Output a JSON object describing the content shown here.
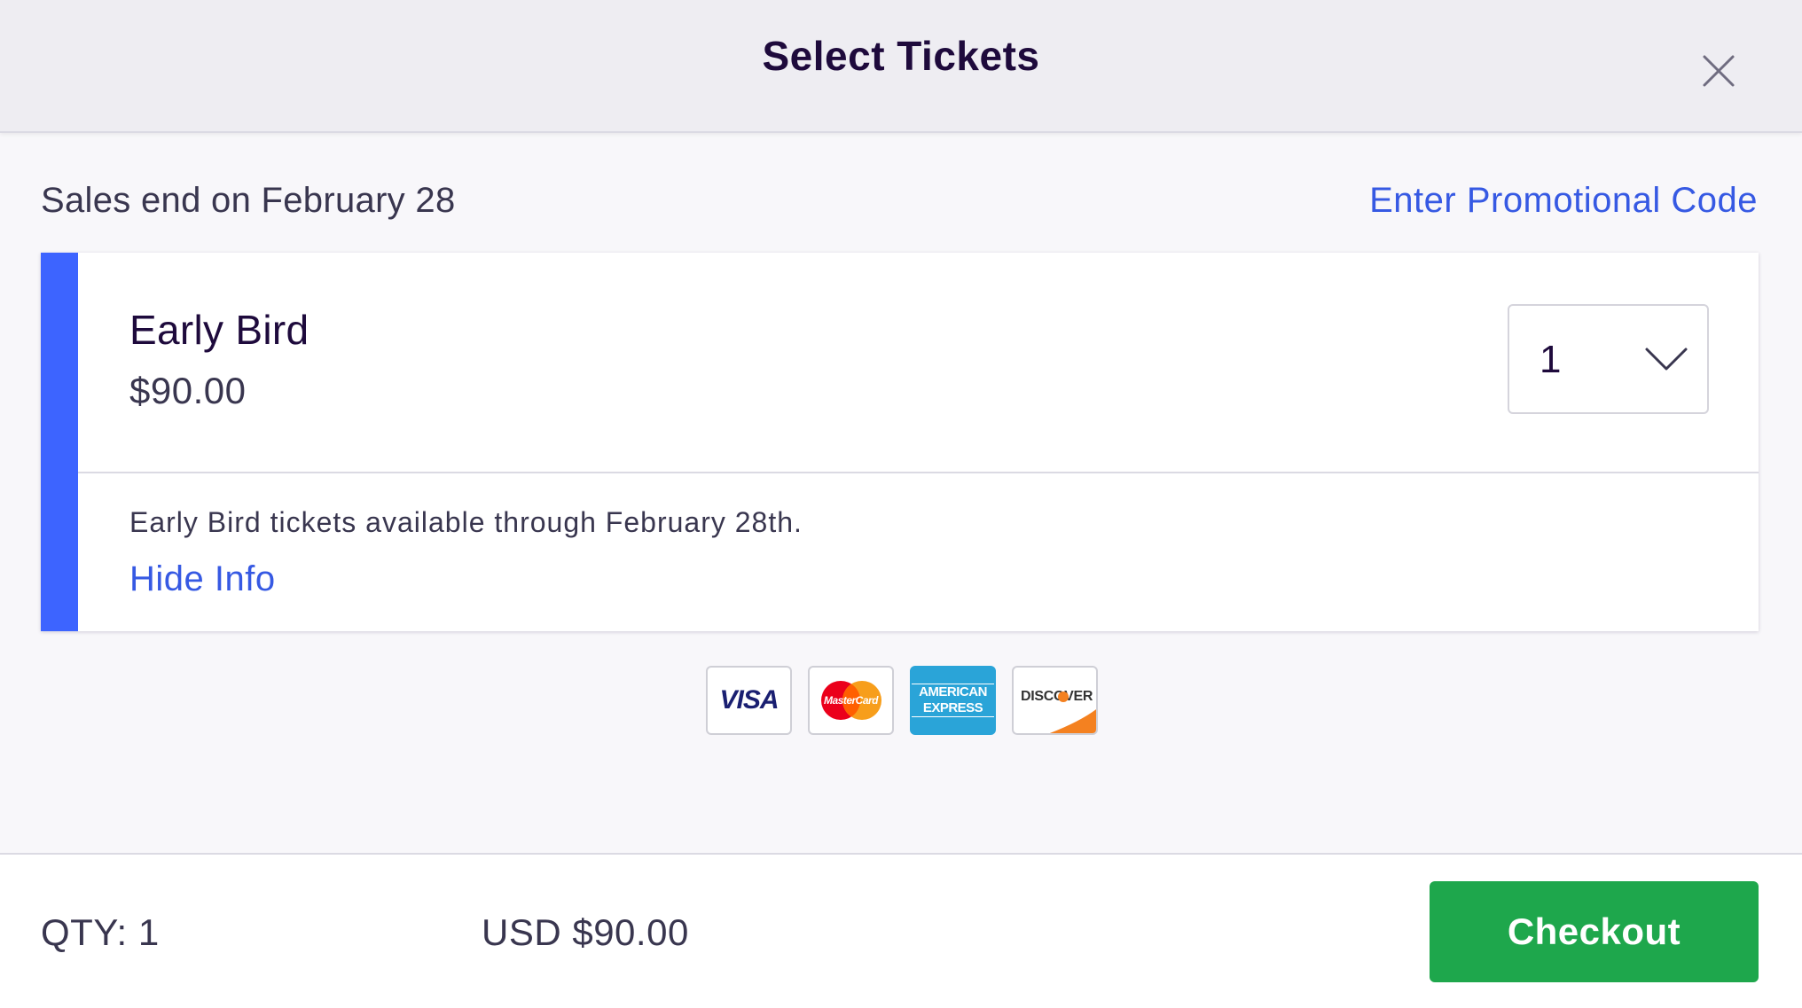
{
  "header": {
    "title": "Select Tickets",
    "close_icon": "close-icon"
  },
  "sales": {
    "end_text": "Sales end on February 28",
    "promo_link": "Enter Promotional Code"
  },
  "ticket": {
    "name": "Early Bird",
    "price": "$90.00",
    "quantity": "1",
    "info": "Early Bird tickets available through February 28th.",
    "hide_info": "Hide Info",
    "accent_color": "#3d64ff"
  },
  "payment_methods": [
    {
      "name": "VISA",
      "icon": "visa-card-icon"
    },
    {
      "name": "MasterCard",
      "icon": "mastercard-icon"
    },
    {
      "name": "AMERICAN EXPRESS",
      "icon": "amex-card-icon"
    },
    {
      "name": "DISCOVER",
      "icon": "discover-card-icon"
    }
  ],
  "footer": {
    "qty": "QTY: 1",
    "total": "USD $90.00",
    "checkout": "Checkout",
    "checkout_color": "#1ea74c"
  },
  "colors": {
    "link": "#3659e3",
    "text_primary": "#1e0a3c"
  }
}
